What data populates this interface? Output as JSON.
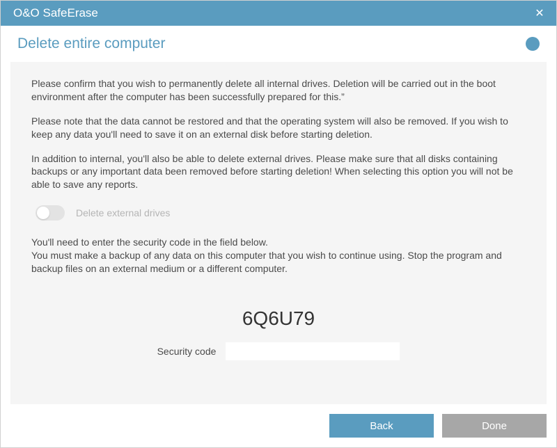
{
  "titlebar": {
    "title": "O&O SafeErase"
  },
  "header": {
    "page_title": "Delete entire computer"
  },
  "content": {
    "para1": "Please confirm that you wish to permanently delete all internal drives. Deletion will be carried out in the boot environment after the computer has been successfully prepared for this.”",
    "para2": "Please note that the data cannot be restored and that the operating system will also be removed. If you wish to keep any data you'll need to save it on an external disk before starting deletion.",
    "para3": "In addition to internal, you'll also be able to delete external drives. Please make sure that all disks containing backups or any important data been removed before starting deletion! When selecting this option you will not be able to save any reports.",
    "toggle_label": "Delete external drives",
    "para4_line1": "You'll need to enter the security code in the field below.",
    "para4_line2": "You must make a backup of any data on this computer that you wish to continue using. Stop the program and backup files on an external medium or a different computer.",
    "security_code_display": "6Q6U79",
    "security_code_label": "Security code",
    "security_code_value": ""
  },
  "buttons": {
    "back": "Back",
    "done": "Done"
  }
}
